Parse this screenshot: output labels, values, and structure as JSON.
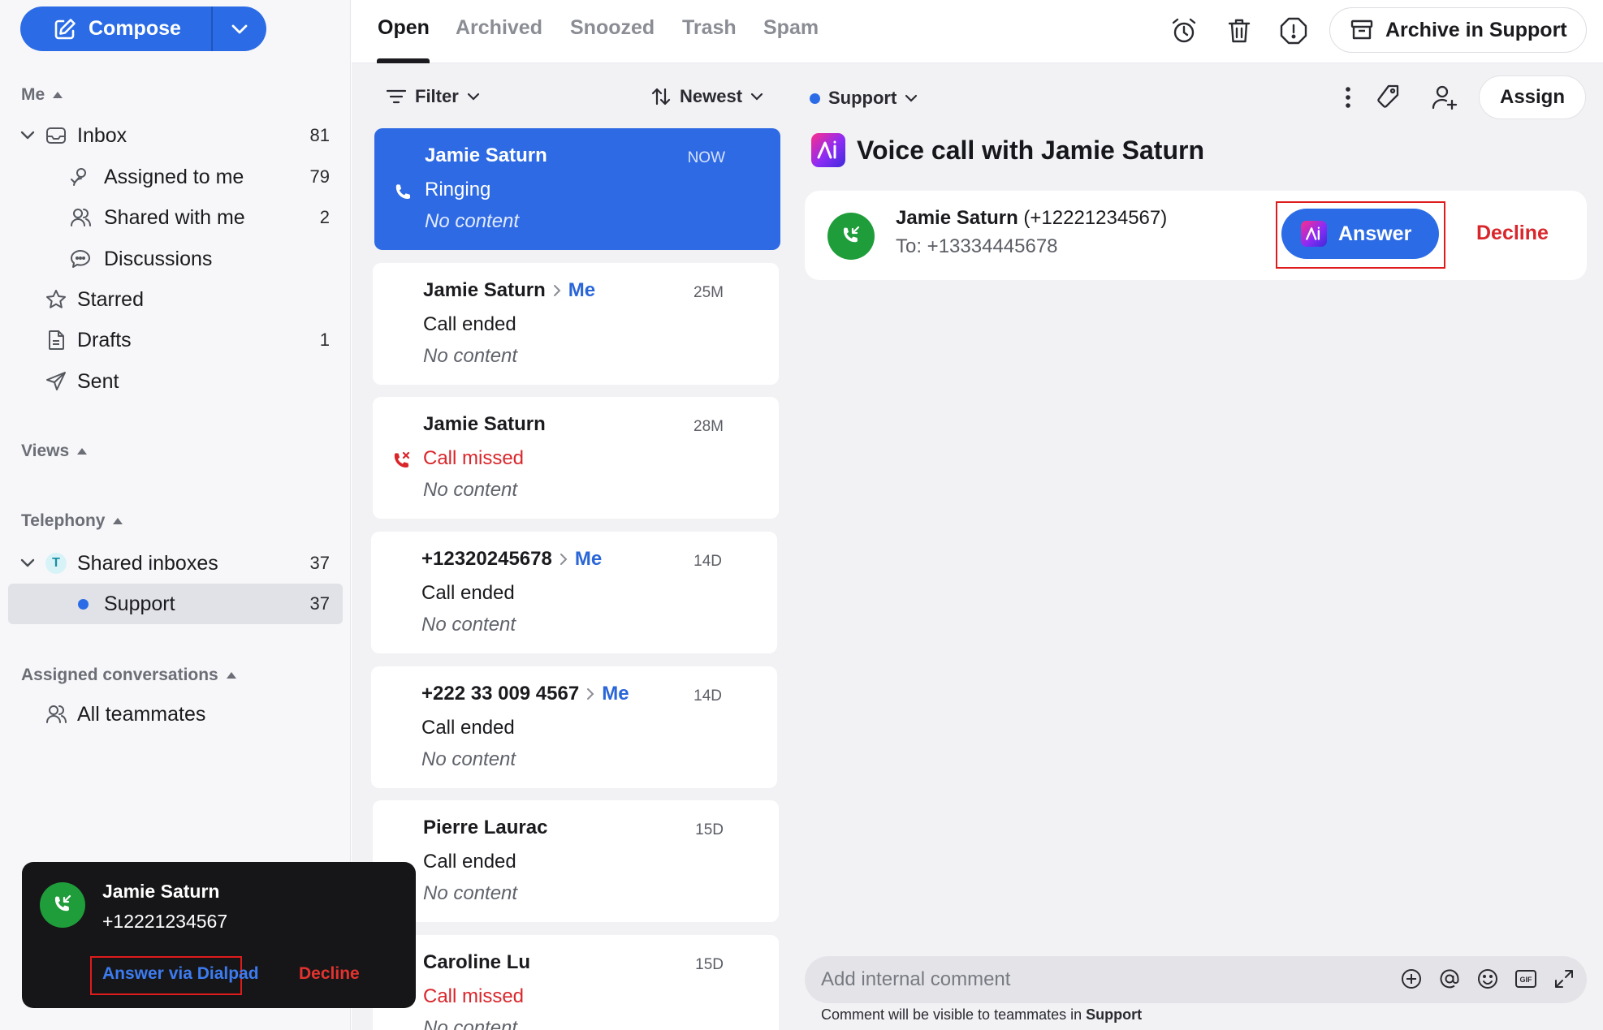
{
  "sidebar": {
    "compose_label": "Compose",
    "me_section": "Me",
    "inbox": {
      "label": "Inbox",
      "count": "81"
    },
    "assigned_to_me": {
      "label": "Assigned to me",
      "count": "79"
    },
    "shared_with_me": {
      "label": "Shared with me",
      "count": "2"
    },
    "discussions": {
      "label": "Discussions"
    },
    "starred": {
      "label": "Starred"
    },
    "drafts": {
      "label": "Drafts",
      "count": "1"
    },
    "sent": {
      "label": "Sent"
    },
    "views_section": "Views",
    "telephony_section": "Telephony",
    "shared_inboxes": {
      "label": "Shared inboxes",
      "count": "37",
      "badge": "T"
    },
    "support": {
      "label": "Support",
      "count": "37"
    },
    "assigned_section": "Assigned conversations",
    "all_teammates": {
      "label": "All teammates"
    }
  },
  "tabs": [
    "Open",
    "Archived",
    "Snoozed",
    "Trash",
    "Spam"
  ],
  "toolbar": {
    "icons": [
      "alarm-clock-icon",
      "trash-icon",
      "spam-alert-icon"
    ],
    "archive_label": "Archive in Support"
  },
  "list": {
    "filter_label": "Filter",
    "sort_label": "Newest",
    "items": [
      {
        "name": "Jamie Saturn",
        "assignee": "",
        "time": "NOW",
        "status": "Ringing",
        "preview": "No content",
        "selected": true
      },
      {
        "name": "Jamie Saturn",
        "assignee": "Me",
        "time": "25M",
        "status": "Call ended",
        "preview": "No content"
      },
      {
        "name": "Jamie Saturn",
        "assignee": "",
        "time": "28M",
        "status": "Call missed",
        "preview": "No content",
        "missed": true
      },
      {
        "name": "+12320245678",
        "assignee": "Me",
        "time": "14D",
        "status": "Call ended",
        "preview": "No content"
      },
      {
        "name": "+222 33 009 4567",
        "assignee": "Me",
        "time": "14D",
        "status": "Call ended",
        "preview": "No content"
      },
      {
        "name": "Pierre Laurac",
        "assignee": "",
        "time": "15D",
        "status": "Call ended",
        "preview": "No content"
      },
      {
        "name": "Caroline Lu",
        "assignee": "",
        "time": "15D",
        "status": "Call missed",
        "preview": "No content",
        "missed": true
      }
    ]
  },
  "detail": {
    "team_label": "Support",
    "assign_label": "Assign",
    "title": "Voice call with Jamie Saturn",
    "call": {
      "caller_name": "Jamie Saturn",
      "caller_number": "(+12221234567)",
      "to": "To: +13334445678",
      "answer_label": "Answer",
      "decline_label": "Decline"
    },
    "comment": {
      "placeholder": "Add internal comment",
      "note_prefix": "Comment will be visible to teammates in",
      "note_team": "Support"
    }
  },
  "popup": {
    "name": "Jamie Saturn",
    "number": "+12221234567",
    "answer_label": "Answer via Dialpad",
    "decline_label": "Decline"
  },
  "colors": {
    "accent": "#2b6ce6",
    "missed": "#d9262b",
    "call_green": "#1f9d3a",
    "highlight_outline": "#e01b1b"
  }
}
